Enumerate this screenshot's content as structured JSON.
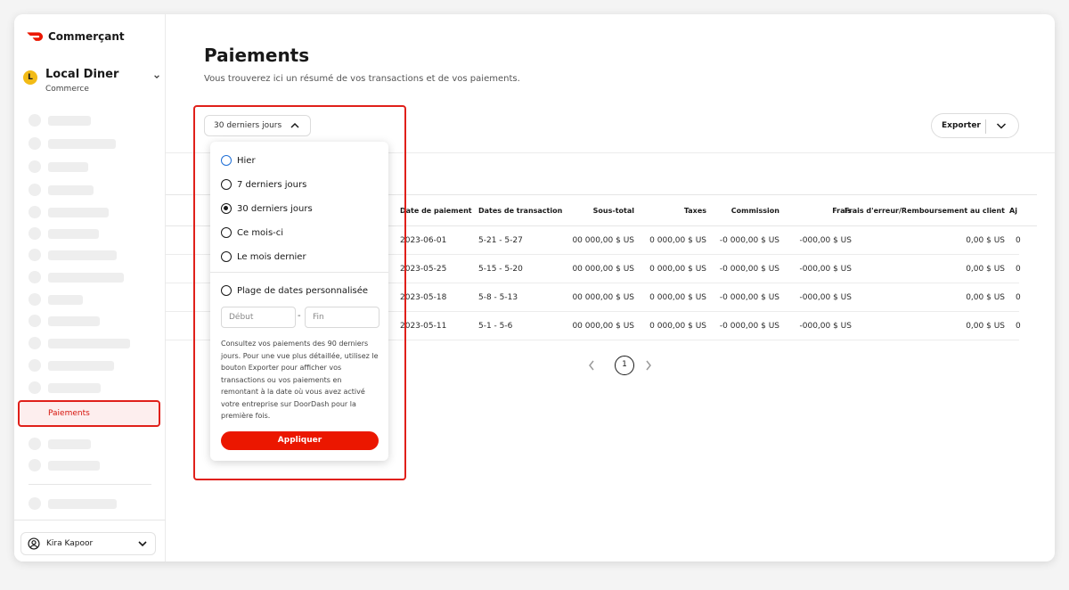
{
  "sidebar": {
    "brand": "Commerçant",
    "store": {
      "initial": "L",
      "name": "Local Diner",
      "type": "Commerce"
    },
    "active_item": "Paiements",
    "user": "Kira Kapoor"
  },
  "page": {
    "title": "Paiements",
    "subtitle": "Vous trouverez ici un résumé de vos transactions et de vos paiements."
  },
  "filter": {
    "label": "30 derniers jours"
  },
  "export": {
    "label": "Exporter"
  },
  "dropdown": {
    "options": [
      "Hier",
      "7 derniers jours",
      "30 derniers jours",
      "Ce mois-ci",
      "Le mois dernier"
    ],
    "selected": "30 derniers jours",
    "custom_label": "Plage de dates personnalisée",
    "start_placeholder": "Début",
    "end_placeholder": "Fin",
    "help": "Consultez vos paiements des 90 derniers jours. Pour une vue plus détaillée, utilisez le bouton Exporter pour afficher vos transactions ou vos paiements en remontant à la date où vous avez activé votre entreprise sur DoorDash pour la première fois.",
    "apply": "Appliquer"
  },
  "table": {
    "headers": [
      "Date de paiement",
      "Dates de transaction",
      "Sous-total",
      "Taxes",
      "Commission",
      "Frais",
      "Frais d'erreur/Remboursement au client",
      "Aj"
    ],
    "rows": [
      [
        "2023-06-01",
        "5-21 - 5-27",
        "00 000,00 $ US",
        "0 000,00 $ US",
        "-0 000,00 $ US",
        "-000,00 $ US",
        "0,00 $ US",
        "0"
      ],
      [
        "2023-05-25",
        "5-15 - 5-20",
        "00 000,00 $ US",
        "0 000,00 $ US",
        "-0 000,00 $ US",
        "-000,00 $ US",
        "0,00 $ US",
        "0"
      ],
      [
        "2023-05-18",
        "5-8 - 5-13",
        "00 000,00 $ US",
        "0 000,00 $ US",
        "-0 000,00 $ US",
        "-000,00 $ US",
        "0,00 $ US",
        "0"
      ],
      [
        "2023-05-11",
        "5-1 - 5-6",
        "00 000,00 $ US",
        "0 000,00 $ US",
        "-0 000,00 $ US",
        "-000,00 $ US",
        "0,00 $ US",
        "0"
      ]
    ]
  },
  "pagination": {
    "current": "1"
  },
  "colors": {
    "brand_red": "#eb1700",
    "highlight": "#e0201a"
  }
}
